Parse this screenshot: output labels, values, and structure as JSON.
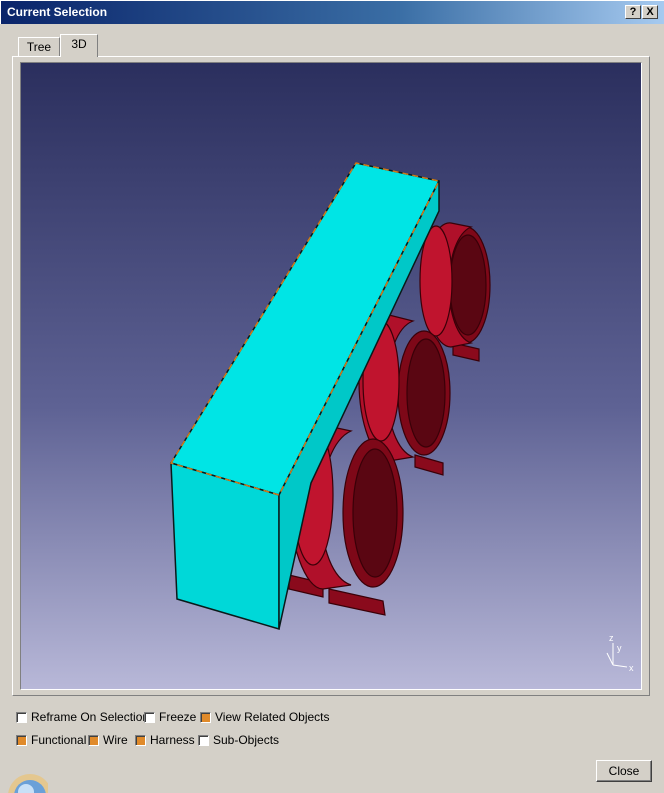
{
  "window": {
    "title": "Current Selection",
    "help_button": "?",
    "close_button": "X"
  },
  "tabs": [
    {
      "label": "Tree",
      "active": false
    },
    {
      "label": "3D",
      "active": true
    }
  ],
  "viewport": {
    "background_top": "#2b2f5e",
    "background_bottom": "#b8b8d8",
    "part_color": "#00e5e5",
    "connector_color": "#b0102a",
    "axis": {
      "x": "x",
      "y": "y",
      "z": "z"
    }
  },
  "options": {
    "reframe": {
      "label": "Reframe On Selection",
      "checked": false
    },
    "freeze": {
      "label": "Freeze",
      "checked": false
    },
    "view_related": {
      "label": "View Related Objects",
      "checked": true
    },
    "functional": {
      "label": "Functional",
      "checked": true
    },
    "wire": {
      "label": "Wire",
      "checked": true
    },
    "harness": {
      "label": "Harness",
      "checked": true
    },
    "sub_objects": {
      "label": "Sub-Objects",
      "checked": false
    }
  },
  "footer": {
    "close_label": "Close"
  }
}
